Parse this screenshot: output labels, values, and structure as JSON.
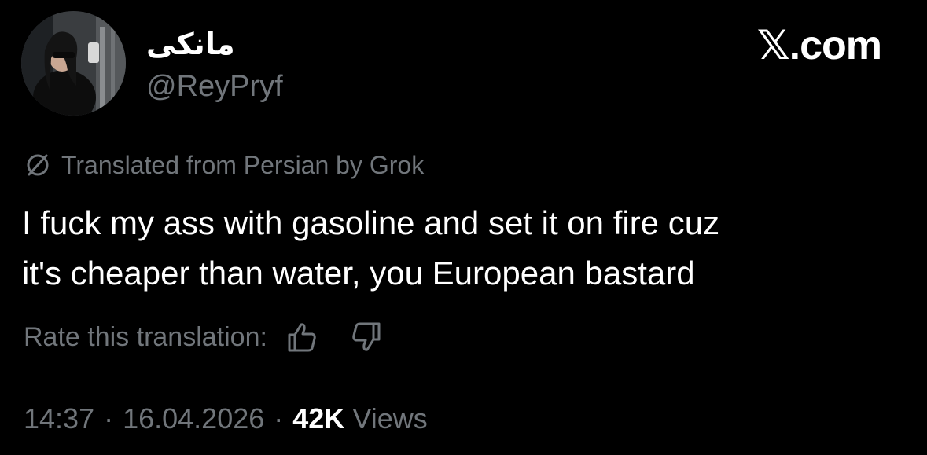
{
  "author": {
    "display_name": "مانکی",
    "handle": "@ReyPryf",
    "avatar_icon": "profile-photo"
  },
  "brand": {
    "label": "𝕏.com"
  },
  "translation": {
    "notice": "Translated from Persian by Grok",
    "notice_icon": "translate-slash-icon",
    "rate_label": "Rate this translation:",
    "thumbs_up_icon": "thumbs-up-icon",
    "thumbs_down_icon": "thumbs-down-icon"
  },
  "tweet": {
    "text_lines": [
      "I fuck my ass with gasoline and set it on fire cuz",
      "it's cheaper than water, you European bastard"
    ]
  },
  "meta": {
    "time": "14:37",
    "separator": "·",
    "date": "16.04.2026",
    "views_count": "42K",
    "views_label": "Views"
  },
  "colors": {
    "background": "#000000",
    "primary_text": "#ffffff",
    "secondary_text": "#71767b"
  }
}
